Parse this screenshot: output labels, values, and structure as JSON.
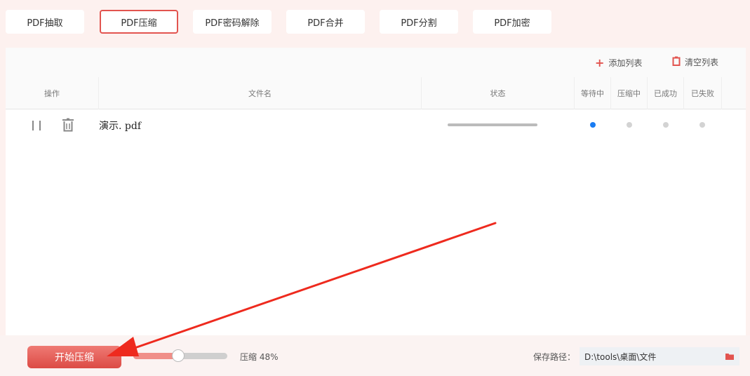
{
  "tabs": [
    {
      "label": "PDF抽取",
      "active": false
    },
    {
      "label": "PDF压缩",
      "active": true
    },
    {
      "label": "PDF密码解除",
      "active": false
    },
    {
      "label": "PDF合并",
      "active": false
    },
    {
      "label": "PDF分割",
      "active": false
    },
    {
      "label": "PDF加密",
      "active": false
    }
  ],
  "toolbar": {
    "add_label": "添加列表",
    "clear_label": "清空列表"
  },
  "table": {
    "headers": [
      "操作",
      "文件名",
      "状态",
      "等待中",
      "压缩中",
      "已成功",
      "已失败"
    ],
    "rows": [
      {
        "file_name": "演示. pdf",
        "active_state": "等待中"
      }
    ]
  },
  "bottom": {
    "start_label": "开始压缩",
    "compress_text": "压缩 48%",
    "compress_percent": 48,
    "save_label": "保存路径：",
    "save_path": "D:\\tools\\桌面\\文件"
  },
  "colors": {
    "accent": "#e2544f",
    "active_dot": "#1a7cf2",
    "arrow": "#ee2a1e"
  },
  "icons": [
    "plus-icon",
    "clipboard-icon",
    "pause-icon",
    "trash-icon",
    "folder-icon"
  ]
}
